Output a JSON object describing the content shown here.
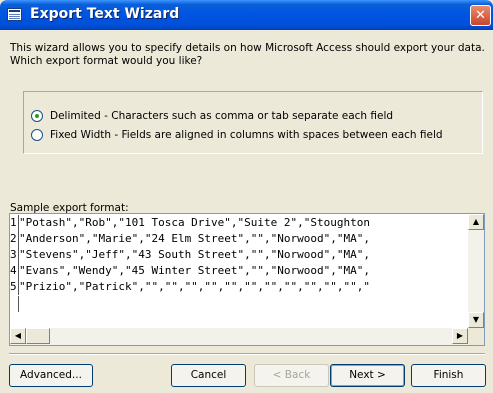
{
  "window": {
    "title": "Export Text Wizard",
    "icon": "wizard-window-icon",
    "close_glyph": "✕"
  },
  "intro_text": "This wizard allows you to specify details on how Microsoft Access should export your data. Which export format would you like?",
  "format_options": [
    {
      "label": "Delimited - Characters such as comma or tab separate each field",
      "selected": true
    },
    {
      "label": "Fixed Width - Fields are aligned in columns with spaces between each field",
      "selected": false
    }
  ],
  "sample": {
    "label": "Sample export format:",
    "lines": [
      {
        "num": "1",
        "text": "\"Potash\",\"Rob\",\"101 Tosca Drive\",\"Suite 2\",\"Stoughton"
      },
      {
        "num": "2",
        "text": "\"Anderson\",\"Marie\",\"24 Elm Street\",\"\",\"Norwood\",\"MA\","
      },
      {
        "num": "3",
        "text": "\"Stevens\",\"Jeff\",\"43 South Street\",\"\",\"Norwood\",\"MA\","
      },
      {
        "num": "4",
        "text": "\"Evans\",\"Wendy\",\"45 Winter Street\",\"\",\"Norwood\",\"MA\","
      },
      {
        "num": "5",
        "text": "\"Prizio\",\"Patrick\",\"\",\"\",\"\",\"\",\"\",\"\",\"\",\"\",\"\",\"\",\"\",\""
      }
    ],
    "scroll_up": "▲",
    "scroll_down": "▼",
    "scroll_left": "◀",
    "scroll_right": "▶"
  },
  "buttons": {
    "advanced": "Advanced...",
    "cancel": "Cancel",
    "back": "< Back",
    "next": "Next >",
    "finish": "Finish"
  }
}
